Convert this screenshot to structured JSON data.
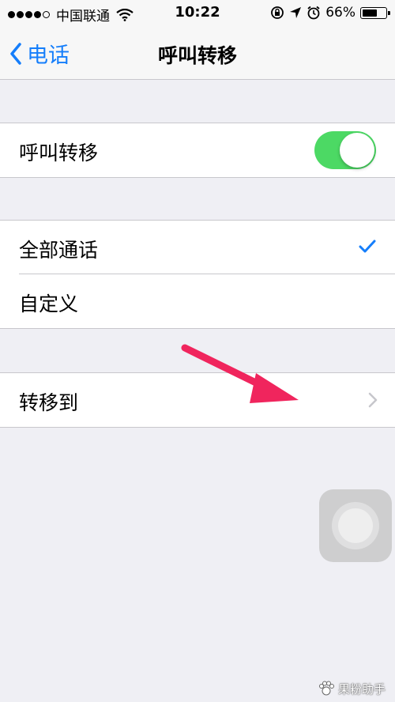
{
  "status_bar": {
    "carrier": "中国联通",
    "time": "10:22",
    "battery": "66%",
    "battery_level": 0.66,
    "signal_bars_filled": 4,
    "signal_bars_total": 5
  },
  "nav": {
    "back_label": "电话",
    "title": "呼叫转移"
  },
  "forwarding": {
    "label": "呼叫转移",
    "enabled": true
  },
  "options": [
    {
      "label": "全部通话",
      "selected": true
    },
    {
      "label": "自定义",
      "selected": false
    }
  ],
  "forward_to": {
    "label": "转移到"
  },
  "colors": {
    "accent": "#157efb",
    "toggle_on": "#4cd964",
    "arrow": "#f0255d",
    "background": "#efeff4"
  },
  "watermark": {
    "text": "果粉助手"
  }
}
